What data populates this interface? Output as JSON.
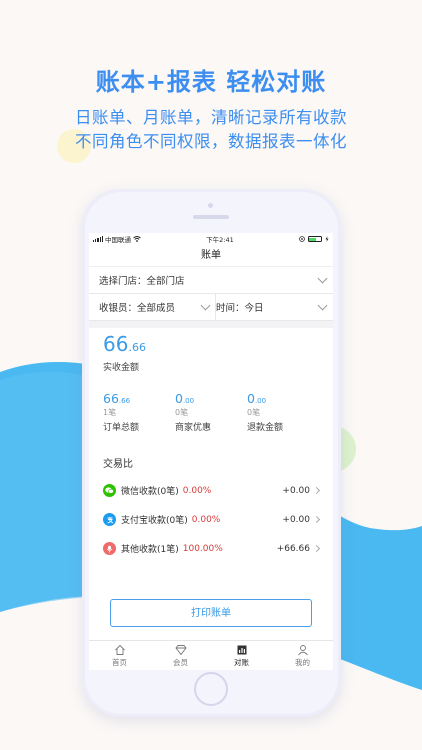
{
  "promo": {
    "headline": "账本+报表 轻松对账",
    "sub1": "日账单、月账单，清晰记录所有收款",
    "sub2": "不同角色不同权限，数据报表一体化"
  },
  "status_bar": {
    "carrier": "中国联通",
    "time": "下午2:41"
  },
  "page": {
    "title": "账单"
  },
  "filters": {
    "store": "选择门店：全部门店",
    "cashier": "收银员：全部成员",
    "time": "时间：今日"
  },
  "summary": {
    "actual_int": "66",
    "actual_dec": ".66",
    "actual_label": "实收金额",
    "stats": [
      {
        "int": "66",
        "dec": ".66",
        "count": "1笔",
        "label": "订单总额"
      },
      {
        "int": "0",
        "dec": ".00",
        "count": "0笔",
        "label": "商家优惠"
      },
      {
        "int": "0",
        "dec": ".00",
        "count": "0笔",
        "label": "退款金额"
      }
    ]
  },
  "trade": {
    "title": "交易比",
    "rows": [
      {
        "name": "微信收款(0笔)",
        "pct": "0.00%",
        "amount": "+0.00",
        "icon": "wechat-icon",
        "color": "#2dc100"
      },
      {
        "name": "支付宝收款(0笔)",
        "pct": "0.00%",
        "amount": "+0.00",
        "icon": "alipay-icon",
        "color": "#1a9cf0"
      },
      {
        "name": "其他收款(1笔)",
        "pct": "100.00%",
        "amount": "+66.66",
        "icon": "other-pay-icon",
        "color": "#f06a6a"
      }
    ]
  },
  "print_button": "打印账单",
  "tabs": [
    {
      "label": "首页",
      "icon": "home-icon"
    },
    {
      "label": "会员",
      "icon": "member-icon"
    },
    {
      "label": "对账",
      "icon": "report-icon"
    },
    {
      "label": "我的",
      "icon": "profile-icon"
    }
  ]
}
